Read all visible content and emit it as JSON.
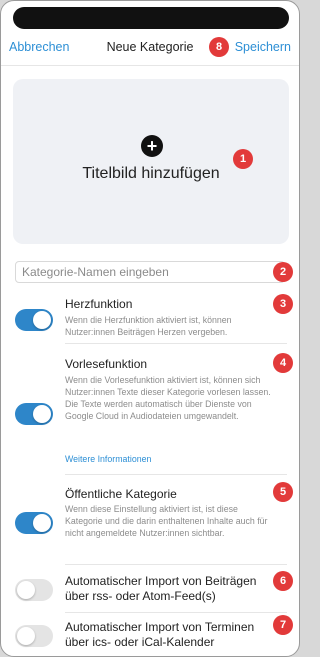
{
  "header": {
    "cancel_label": "Abbrechen",
    "title": "Neue Kategorie",
    "save_label": "Speichern"
  },
  "image_upload": {
    "icon": "plus-circle-icon",
    "label": "Titelbild hinzufügen"
  },
  "name_field": {
    "placeholder": "Kategorie-Namen eingeben",
    "value": ""
  },
  "settings": [
    {
      "title": "Herzfunktion",
      "description": "Wenn die Herzfunktion aktiviert ist, können Nutzer:innen Beiträgen Herzen vergeben.",
      "enabled": true
    },
    {
      "title": "Vorlesefunktion",
      "description": "Wenn die Vorlesefunktion aktiviert ist, können sich Nutzer:innen Texte dieser Kategorie vorlesen lassen. Die Texte werden automatisch über Dienste von Google Cloud in Audiodateien umgewandelt.",
      "link": "Weitere Informationen",
      "enabled": true
    },
    {
      "title": "Öffentliche Kategorie",
      "description": "Wenn diese Einstellung aktiviert ist, ist diese Kategorie und die darin enthaltenen Inhalte auch für nicht angemeldete Nutzer:innen sichtbar.",
      "enabled": true
    },
    {
      "title": "Automatischer Import von Beiträgen über rss- oder Atom-Feed(s)",
      "enabled": false
    },
    {
      "title": "Automatischer Import von Terminen über ics- oder iCal-Kalender",
      "enabled": false
    }
  ],
  "badges": [
    "1",
    "2",
    "3",
    "4",
    "5",
    "6",
    "7",
    "8"
  ],
  "colors": {
    "accent": "#2d8fd5",
    "toggle_on": "#2e86c9",
    "badge": "#e23a3a"
  }
}
